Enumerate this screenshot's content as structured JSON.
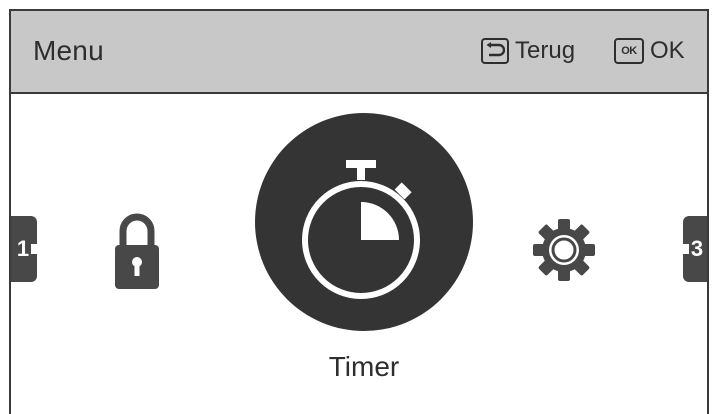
{
  "header": {
    "title": "Menu",
    "back_label": "Terug",
    "ok_key_label": "OK",
    "ok_label": "OK"
  },
  "menu": {
    "prev_page": "1",
    "next_page": "3",
    "items": [
      {
        "icon": "lock-icon",
        "selected": false
      },
      {
        "icon": "stopwatch-icon",
        "label": "Timer",
        "selected": true
      },
      {
        "icon": "gear-icon",
        "selected": false
      }
    ]
  },
  "colors": {
    "header_bg": "#c8c8c8",
    "icon_dark": "#343434",
    "text": "#2e2e2e",
    "background": "#ffffff"
  }
}
